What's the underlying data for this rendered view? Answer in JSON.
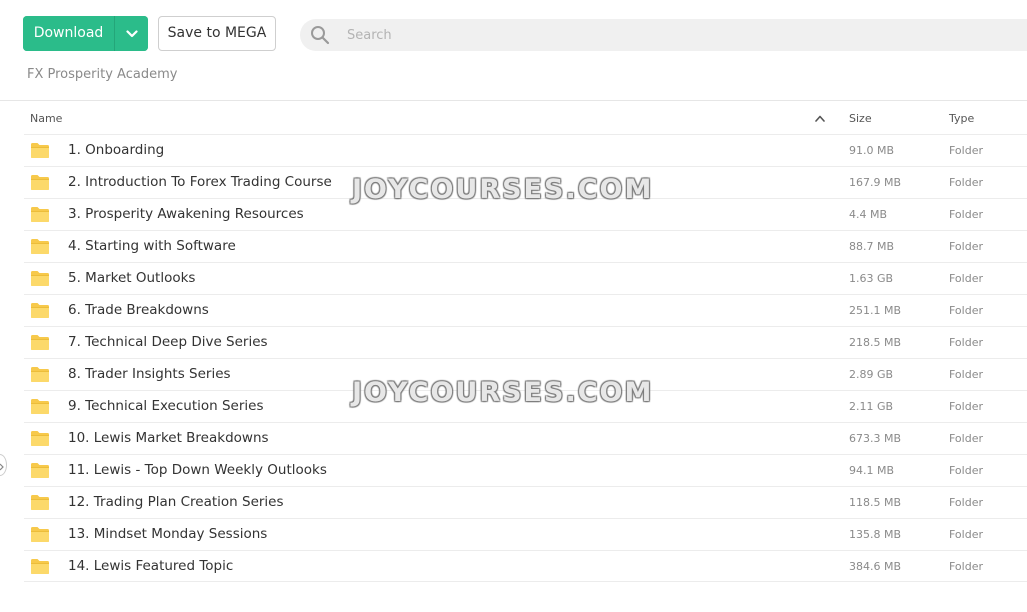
{
  "toolbar": {
    "download_label": "Download",
    "save_label": "Save to MEGA",
    "accent_color": "#2bbc8a"
  },
  "search": {
    "placeholder": "Search"
  },
  "breadcrumb": "FX Prosperity Academy",
  "table": {
    "columns": {
      "name": "Name",
      "size": "Size",
      "type": "Type"
    },
    "sort": "name-ascending",
    "rows": [
      {
        "name": "1. Onboarding",
        "size": "91.0 MB",
        "type": "Folder",
        "icon": "folder-icon"
      },
      {
        "name": "2. Introduction To Forex Trading Course",
        "size": "167.9 MB",
        "type": "Folder",
        "icon": "folder-icon"
      },
      {
        "name": "3. Prosperity Awakening Resources",
        "size": "4.4 MB",
        "type": "Folder",
        "icon": "folder-icon"
      },
      {
        "name": "4. Starting with Software",
        "size": "88.7 MB",
        "type": "Folder",
        "icon": "folder-icon"
      },
      {
        "name": "5. Market Outlooks",
        "size": "1.63 GB",
        "type": "Folder",
        "icon": "folder-icon"
      },
      {
        "name": "6. Trade Breakdowns",
        "size": "251.1 MB",
        "type": "Folder",
        "icon": "folder-icon"
      },
      {
        "name": "7. Technical Deep Dive Series",
        "size": "218.5 MB",
        "type": "Folder",
        "icon": "folder-icon"
      },
      {
        "name": "8. Trader Insights Series",
        "size": "2.89 GB",
        "type": "Folder",
        "icon": "folder-icon"
      },
      {
        "name": "9. Technical Execution Series",
        "size": "2.11 GB",
        "type": "Folder",
        "icon": "folder-icon"
      },
      {
        "name": "10. Lewis Market Breakdowns",
        "size": "673.3 MB",
        "type": "Folder",
        "icon": "folder-icon"
      },
      {
        "name": "11. Lewis - Top Down Weekly Outlooks",
        "size": "94.1 MB",
        "type": "Folder",
        "icon": "folder-icon"
      },
      {
        "name": "12. Trading Plan Creation Series",
        "size": "118.5 MB",
        "type": "Folder",
        "icon": "folder-icon"
      },
      {
        "name": "13. Mindset Monday Sessions",
        "size": "135.8 MB",
        "type": "Folder",
        "icon": "folder-icon"
      },
      {
        "name": "14. Lewis Featured Topic",
        "size": "384.6 MB",
        "type": "Folder",
        "icon": "folder-icon"
      }
    ]
  },
  "watermarks": [
    "JOYCOURSES.COM",
    "JOYCOURSES.COM"
  ]
}
